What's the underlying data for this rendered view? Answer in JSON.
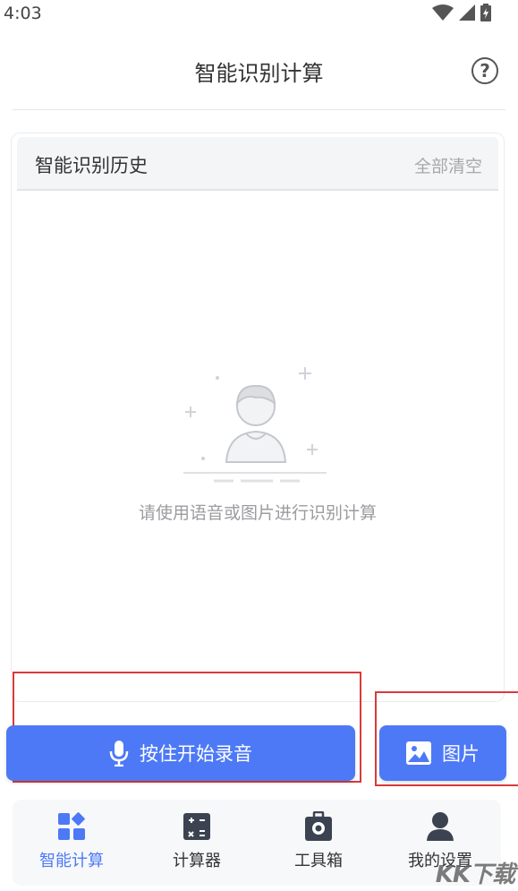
{
  "status_bar": {
    "time": "4:03"
  },
  "header": {
    "title": "智能识别计算"
  },
  "history": {
    "title": "智能识别历史",
    "clear_label": "全部清空",
    "empty_message": "请使用语音或图片进行识别计算"
  },
  "actions": {
    "record_label": "按住开始录音",
    "image_label": "图片"
  },
  "tabs": [
    {
      "label": "智能计算",
      "icon": "grid-icon",
      "active": true
    },
    {
      "label": "计算器",
      "icon": "calculator-icon",
      "active": false
    },
    {
      "label": "工具箱",
      "icon": "toolbox-icon",
      "active": false
    },
    {
      "label": "我的设置",
      "icon": "user-icon",
      "active": false
    }
  ],
  "colors": {
    "accent": "#4d79f6",
    "annotation": "#d93a3a"
  },
  "watermark": "KK下载"
}
